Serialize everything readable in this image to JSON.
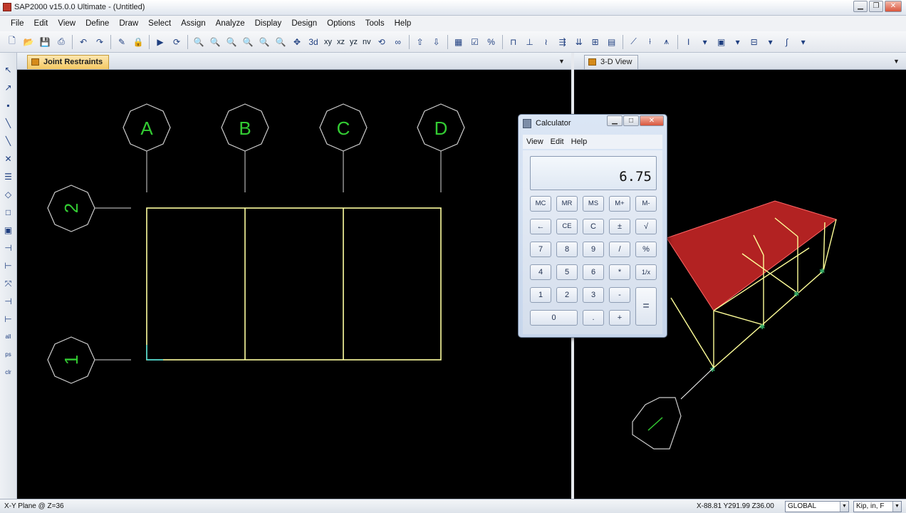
{
  "window": {
    "title": "SAP2000 v15.0.0 Ultimate  - (Untitled)"
  },
  "menubar": {
    "items": [
      "File",
      "Edit",
      "View",
      "Define",
      "Draw",
      "Select",
      "Assign",
      "Analyze",
      "Display",
      "Design",
      "Options",
      "Tools",
      "Help"
    ]
  },
  "toolbar": {
    "view_buttons": [
      "xy",
      "xz",
      "yz",
      "nv"
    ]
  },
  "panes": {
    "left": {
      "tab": "Joint Restraints"
    },
    "right": {
      "tab": "3-D View"
    }
  },
  "grid": {
    "columns": [
      "A",
      "B",
      "C",
      "D"
    ],
    "rows": [
      "2",
      "1"
    ]
  },
  "calculator": {
    "title": "Calculator",
    "menu": [
      "View",
      "Edit",
      "Help"
    ],
    "display": "6.75",
    "memory_row": [
      "MC",
      "MR",
      "MS",
      "M+",
      "M-"
    ],
    "row2": [
      "←",
      "CE",
      "C",
      "±",
      "√"
    ],
    "row3": [
      "7",
      "8",
      "9",
      "/",
      "%"
    ],
    "row4": [
      "4",
      "5",
      "6",
      "*",
      "1/x"
    ],
    "row5": [
      "1",
      "2",
      "3",
      "-"
    ],
    "row6": [
      "0",
      ".",
      "+"
    ],
    "equals": "="
  },
  "statusbar": {
    "left": "X-Y Plane @ Z=36",
    "coords": "X-88.81  Y291.99  Z36.00",
    "coord_system": "GLOBAL",
    "units": "Kip, in, F"
  },
  "colors": {
    "grid_bubble": "#33cc33",
    "frame": "#ffff99",
    "slab": "#b22222",
    "viewport_bg": "#000000"
  }
}
